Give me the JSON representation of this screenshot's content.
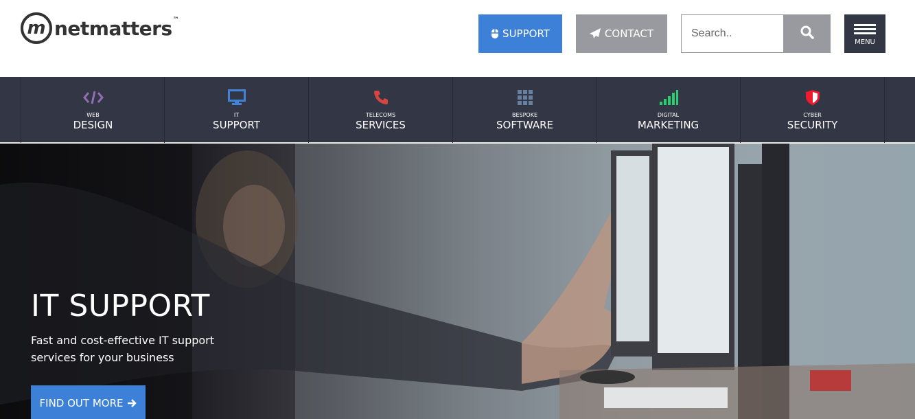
{
  "header": {
    "logo": {
      "mark": "m",
      "text": "netmatters",
      "tm": "™"
    },
    "support_label": "SUPPORT",
    "contact_label": "CONTACT",
    "search": {
      "placeholder": "Search.."
    },
    "menu_label": "MENU"
  },
  "services": [
    {
      "small": "WEB",
      "big": "DESIGN",
      "icon": "code-icon",
      "color": "#926fb1"
    },
    {
      "small": "IT",
      "big": "SUPPORT",
      "icon": "monitor-icon",
      "color": "#4183d7"
    },
    {
      "small": "TELECOMS",
      "big": "SERVICES",
      "icon": "phone-icon",
      "color": "#d64541"
    },
    {
      "small": "BESPOKE",
      "big": "SOFTWARE",
      "icon": "grid-icon",
      "color": "#67809f"
    },
    {
      "small": "DIGITAL",
      "big": "MARKETING",
      "icon": "signal-icon",
      "color": "#2ecc71"
    },
    {
      "small": "CYBER",
      "big": "SECURITY",
      "icon": "shield-icon",
      "color": "#ee1c2d"
    }
  ],
  "hero": {
    "title": "IT SUPPORT",
    "subtitle": "Fast and cost-effective IT support services for your business",
    "cta_label": "FIND OUT MORE"
  },
  "colors": {
    "accent_blue": "#3d80d8",
    "gray_button": "#999aa0",
    "nav_dark": "#333645"
  }
}
